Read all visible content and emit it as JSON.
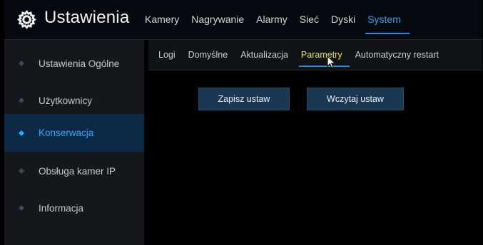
{
  "header": {
    "title": "Ustawienia",
    "logo_icon": "gear-icon",
    "tabs": [
      {
        "label": "Kamery"
      },
      {
        "label": "Nagrywanie"
      },
      {
        "label": "Alarmy"
      },
      {
        "label": "Sieć"
      },
      {
        "label": "Dyski"
      },
      {
        "label": "System",
        "active": true
      }
    ]
  },
  "sidebar": {
    "items": [
      {
        "label": "Ustawienia Ogólne"
      },
      {
        "label": "Użytkownicy"
      },
      {
        "label": "Konserwacja",
        "active": true
      },
      {
        "label": "Obsługa kamer IP"
      },
      {
        "label": "Informacja"
      }
    ]
  },
  "subtabs": [
    {
      "label": "Logi"
    },
    {
      "label": "Domyślne"
    },
    {
      "label": "Aktualizacja"
    },
    {
      "label": "Parametry",
      "active": true
    },
    {
      "label": "Automatyczny restart"
    }
  ],
  "buttons": {
    "save": "Zapisz ustaw",
    "load": "Wczytaj ustaw"
  },
  "colors": {
    "accent": "#29a3f0",
    "active_subtab": "#e7e25b",
    "sidebar_active_bg": "#0c2a46",
    "button_bg": "#1b3852"
  }
}
